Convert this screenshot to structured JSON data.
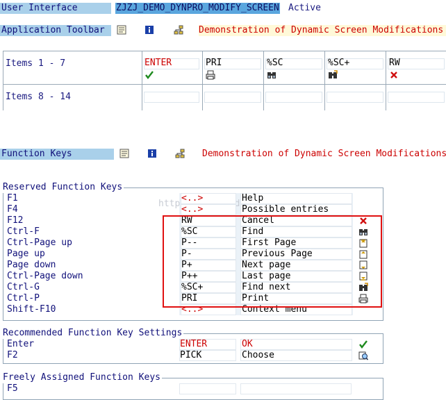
{
  "header": {
    "ui_label": "User Interface",
    "ui_value": "ZJZJ_DEMO_DYNPRO_MODIFY_SCREEN",
    "ui_status": "Active",
    "app_toolbar_label": "Application Toolbar",
    "app_toolbar_text": "Demonstration of Dynamic Screen Modifications"
  },
  "items_grid": {
    "row1_label": "Items  1 -  7",
    "row2_label": "Items  8 - 14",
    "cells": [
      {
        "code": "ENTER",
        "code_color": "red",
        "icon": "check-icon"
      },
      {
        "code": "PRI",
        "code_color": "black",
        "icon": "print-icon"
      },
      {
        "code": "%SC",
        "code_color": "black",
        "icon": "binoculars-icon"
      },
      {
        "code": "%SC+",
        "code_color": "black",
        "icon": "find-next-icon"
      },
      {
        "code": "RW",
        "code_color": "black",
        "icon": "cancel-icon"
      }
    ]
  },
  "function_keys": {
    "label": "Function Keys",
    "text": "Demonstration of Dynamic Screen Modifications"
  },
  "reserved": {
    "title": "Reserved Function Keys",
    "watermark": "http://blog.csdn.net/",
    "rows": [
      {
        "key": "F1",
        "code": "<..>",
        "code_red": true,
        "text": "Help",
        "icon": ""
      },
      {
        "key": "F4",
        "code": "<..>",
        "code_red": true,
        "text": "Possible entries",
        "icon": ""
      },
      {
        "key": "F12",
        "code": "RW",
        "code_red": false,
        "text": "Cancel",
        "icon": "cancel-icon"
      },
      {
        "key": "Ctrl-F",
        "code": "%SC",
        "code_red": false,
        "text": "Find",
        "icon": "binoculars-icon"
      },
      {
        "key": "Ctrl-Page up",
        "code": "P--",
        "code_red": false,
        "text": "First Page",
        "icon": "first-page-icon"
      },
      {
        "key": "Page up",
        "code": "P-",
        "code_red": false,
        "text": "Previous Page",
        "icon": "previous-page-icon"
      },
      {
        "key": "Page down",
        "code": "P+",
        "code_red": false,
        "text": "Next page",
        "icon": "next-page-icon"
      },
      {
        "key": "Ctrl-Page down",
        "code": "P++",
        "code_red": false,
        "text": "Last page",
        "icon": "last-page-icon"
      },
      {
        "key": "Ctrl-G",
        "code": "%SC+",
        "code_red": false,
        "text": "Find next",
        "icon": "find-next-icon"
      },
      {
        "key": "Ctrl-P",
        "code": "PRI",
        "code_red": false,
        "text": "Print",
        "icon": "print-icon"
      },
      {
        "key": "Shift-F10",
        "code": "<..>",
        "code_red": true,
        "text": "Context menu",
        "icon": ""
      }
    ]
  },
  "recommended": {
    "title": "Recommended Function Key Settings",
    "rows": [
      {
        "key": "Enter",
        "code": "ENTER",
        "code_red": true,
        "text": "OK",
        "text_red": true,
        "icon": "check-icon"
      },
      {
        "key": "F2",
        "code": "PICK",
        "code_red": false,
        "text": "Choose",
        "text_red": false,
        "icon": "choose-icon"
      }
    ]
  },
  "freely": {
    "title": "Freely Assigned Function Keys",
    "rows": [
      {
        "key": "F5"
      }
    ]
  }
}
